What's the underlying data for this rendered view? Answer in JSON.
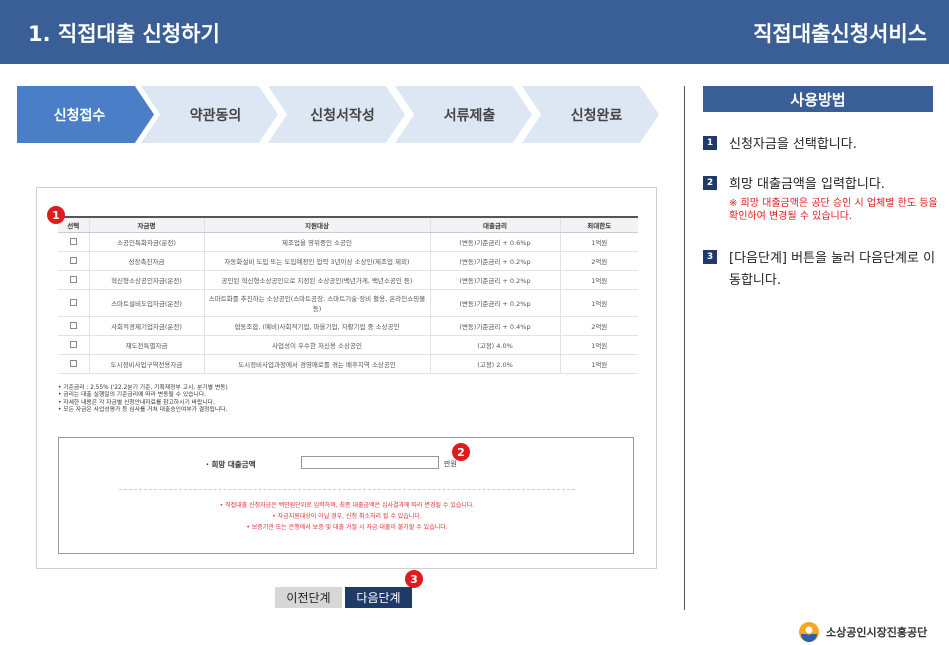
{
  "header": {
    "title": "1. 직접대출 신청하기",
    "service": "직접대출신청서비스"
  },
  "steps": [
    {
      "label": "신청접수",
      "active": true
    },
    {
      "label": "약관동의",
      "active": false
    },
    {
      "label": "신청서작성",
      "active": false
    },
    {
      "label": "서류제출",
      "active": false
    },
    {
      "label": "신청완료",
      "active": false
    }
  ],
  "markers": [
    "1",
    "2",
    "3"
  ],
  "table": {
    "headers": [
      "선택",
      "자금명",
      "지원대상",
      "대출금리",
      "최대한도"
    ],
    "rows": [
      {
        "name": "소공인특화자금(운전)",
        "target": "제조업을 영위중인 소공인",
        "rate": "(변동)기준금리 + 0.6%p",
        "limit": "1억원"
      },
      {
        "name": "성장촉진자금",
        "target": "자동화설비 도입 또는 도입예정인 업력 3년이상 소상인(제조업 제외)",
        "rate": "(변동)기준금리 + 0.2%p",
        "limit": "2억원"
      },
      {
        "name": "혁신형소상공인자금(운전)",
        "target": "공인된 혁신형소상공인으로 지정된 소상공인(백년가게, 백년소공인 등)",
        "rate": "(변동)기준금리 + 0.2%p",
        "limit": "1억원"
      },
      {
        "name": "스마트설비도입자금(운전)",
        "target": "스마트화를 추진하는 소상공인(스마트공장, 스마트기술·장비 활용, 온라인쇼핑몰 등)",
        "rate": "(변동)기준금리 + 0.2%p",
        "limit": "1억원"
      },
      {
        "name": "사회적경제기업자금(운전)",
        "target": "협동조합, (예비)사회적기업, 마을기업, 자활기업 중 소상공인",
        "rate": "(변동)기준금리 + 0.4%p",
        "limit": "2억원"
      },
      {
        "name": "재도전특별자금",
        "target": "사업성이 우수한 저신용 소상공인",
        "rate": "(고정) 4.0%",
        "limit": "1억원"
      },
      {
        "name": "도시정비사업구역전용자금",
        "target": "도시정비사업과정에서 경영애로를 겪는 배후지역 소상공인",
        "rate": "(고정) 2.0%",
        "limit": "1억원"
      }
    ]
  },
  "notes": [
    "• 기준금리 : 2.55% ('22.2분기 기준, 기획재정부 고시, 분기별 변동)",
    "• 금리는 대출 실행일의 기준금리에 따라 변동될 수 있습니다.",
    "• 자세한 내용은 각 자금별 신청안내자료를 참고하시기 바랍니다.",
    "• 모든 자금은 사업성평가 등 심사를 거쳐 대출승인여부가 결정됩니다."
  ],
  "amount": {
    "label": "· 희망 대출금액",
    "value": "",
    "unit": "만원",
    "notes": [
      "• 직접대출 신청자금은 백만원단위로 입력하며, 최종 대출금액은 심사결과에 따라 변경될 수 있습니다.",
      "• 자금지원대상이 아닐 경우, 신청 취소처리 될 수 있습니다.",
      "• 보증기관 또는 은행에서 보증 및 대출 거절 시 자금 대출이 불가할 수 있습니다."
    ]
  },
  "buttons": {
    "prev": "이전단계",
    "next": "다음단계"
  },
  "usage": {
    "title": "사용방법",
    "items": [
      {
        "num": "1",
        "text": "신청자금을 선택합니다.",
        "note": ""
      },
      {
        "num": "2",
        "text": "희망 대출금액을 입력합니다.",
        "note": "※ 희망 대출금액은 공단 승인 시 업체별 한도 등을 확인하여 변경될 수 있습니다."
      },
      {
        "num": "3",
        "text": "[다음단계] 버튼을 눌러 다음단계로 이동합니다.",
        "note": ""
      }
    ]
  },
  "logo": {
    "text": "소상공인시장진흥공단"
  },
  "colors": {
    "header": "#3a5f96",
    "step_active": "#4a7fc7",
    "step_inactive": "#dde7f4",
    "marker": "#e01b1b",
    "next_button": "#1f3a68",
    "note_red": "#e01b1b"
  }
}
